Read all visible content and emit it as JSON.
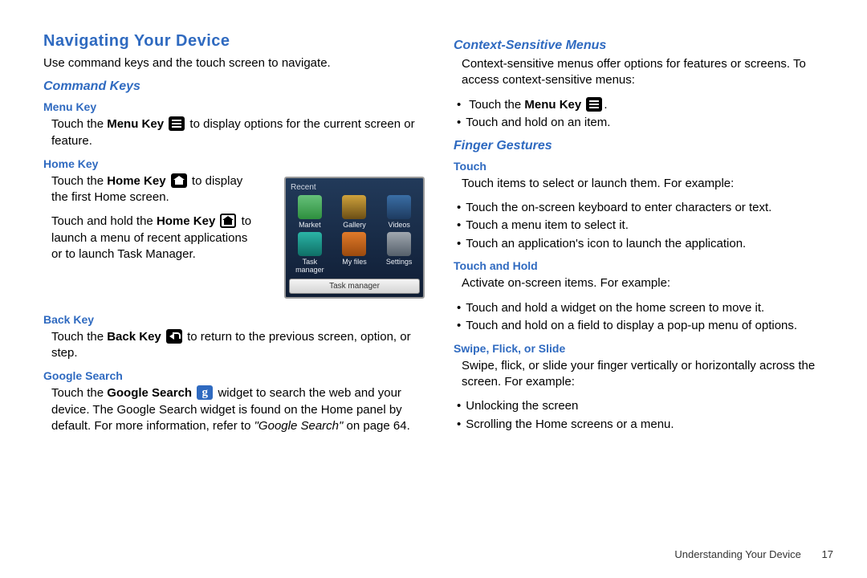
{
  "h1": "Navigating Your Device",
  "intro": "Use command keys and the touch screen to navigate.",
  "command_keys": {
    "title": "Command Keys",
    "menu_key": {
      "title": "Menu Key",
      "pre": "Touch the ",
      "bold": "Menu Key",
      "post": " to display options for the current screen or feature."
    },
    "home_key": {
      "title": "Home Key",
      "p1_pre": "Touch the ",
      "p1_bold": "Home Key",
      "p1_post": " to display the first Home screen.",
      "p2_pre": "Touch and hold the ",
      "p2_bold": "Home Key",
      "p2_post": " to launch a menu of recent applications or to launch Task Manager."
    },
    "back_key": {
      "title": "Back Key",
      "pre": "Touch the ",
      "bold": "Back Key",
      "post": " to return to the previous screen, option, or step."
    },
    "google": {
      "title": "Google Search",
      "pre": "Touch the ",
      "bold": "Google Search",
      "post1": " widget to search the web and your device. The Google Search widget is found on the Home panel by default. For more information, refer to ",
      "ref": "\"Google Search\"",
      "post2": " on page 64."
    }
  },
  "device": {
    "title": "Recent",
    "apps": [
      {
        "label": "Market",
        "color": "linear-gradient(#66c17a,#2e8f3e)"
      },
      {
        "label": "Gallery",
        "color": "linear-gradient(#cfa23c,#6b4e15)"
      },
      {
        "label": "Videos",
        "color": "linear-gradient(#3a6ea5,#1e3b60)"
      },
      {
        "label": "Task manager",
        "color": "linear-gradient(#2bb4a6,#0f6f66)"
      },
      {
        "label": "My files",
        "color": "linear-gradient(#e07a2a,#9b4a0e)"
      },
      {
        "label": "Settings",
        "color": "linear-gradient(#a0a7af,#55606b)"
      }
    ],
    "button": "Task manager"
  },
  "context": {
    "title": "Context-Sensitive Menus",
    "intro": "Context-sensitive menus offer options for features or screens. To access context-sensitive menus:",
    "b1_pre": "Touch the ",
    "b1_bold": "Menu Key",
    "b1_post": ".",
    "b2": "Touch and hold on an item."
  },
  "gestures": {
    "title": "Finger Gestures",
    "touch": {
      "title": "Touch",
      "intro": "Touch items to select or launch them. For example:",
      "items": [
        "Touch the on-screen keyboard to enter characters or text.",
        "Touch a menu item to select it.",
        "Touch an application's icon to launch the application."
      ]
    },
    "hold": {
      "title": "Touch and Hold",
      "intro": "Activate on-screen items. For example:",
      "items": [
        "Touch and hold a widget on the home screen to move it.",
        "Touch and hold on a field to display a pop-up menu of options."
      ]
    },
    "swipe": {
      "title": "Swipe, Flick, or Slide",
      "intro": "Swipe, flick, or slide your finger vertically or horizontally across the screen. For example:",
      "items": [
        "Unlocking the screen",
        "Scrolling the Home screens or a menu."
      ]
    }
  },
  "footer": {
    "section": "Understanding Your Device",
    "page": "17"
  }
}
